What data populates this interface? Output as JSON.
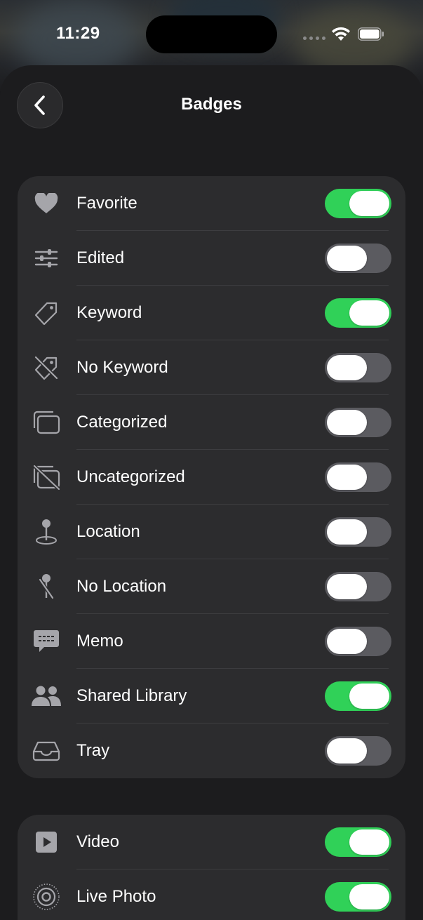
{
  "status_bar": {
    "time": "11:29"
  },
  "header": {
    "title": "Badges",
    "back_icon": "chevron-left-icon"
  },
  "colors": {
    "toggle_on": "#30d158",
    "toggle_off": "#5b5b60",
    "card": "#2c2c2e",
    "sheet": "#1c1c1e"
  },
  "badges": [
    {
      "label": "Favorite",
      "icon": "heart-icon",
      "on": true
    },
    {
      "label": "Edited",
      "icon": "sliders-icon",
      "on": false
    },
    {
      "label": "Keyword",
      "icon": "tag-icon",
      "on": true
    },
    {
      "label": "No Keyword",
      "icon": "tag-slash-icon",
      "on": false
    },
    {
      "label": "Categorized",
      "icon": "stacked-rect-icon",
      "on": false
    },
    {
      "label": "Uncategorized",
      "icon": "stacked-rect-slash-icon",
      "on": false
    },
    {
      "label": "Location",
      "icon": "pin-icon",
      "on": false
    },
    {
      "label": "No Location",
      "icon": "pin-slash-icon",
      "on": false
    },
    {
      "label": "Memo",
      "icon": "speech-bubble-icon",
      "on": false
    },
    {
      "label": "Shared Library",
      "icon": "people-icon",
      "on": true
    },
    {
      "label": "Tray",
      "icon": "tray-icon",
      "on": false
    }
  ],
  "media": [
    {
      "label": "Video",
      "icon": "play-icon",
      "on": true
    },
    {
      "label": "Live Photo",
      "icon": "live-photo-icon",
      "on": true
    }
  ]
}
